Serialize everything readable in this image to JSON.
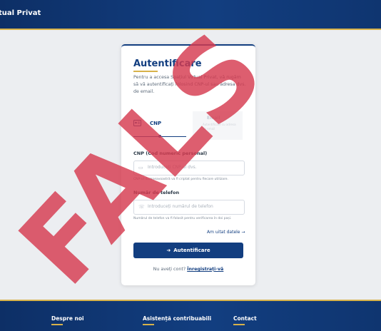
{
  "header": {
    "brand": "tual Privat"
  },
  "card": {
    "title": "Autentificare",
    "description": "Pentru a accesa Spațiul Virtual Privat, vă rugăm să vă autentificați folosind CNP-ul sau adresa dvs. de email.",
    "tabs": [
      {
        "label": "CNP",
        "icon": "id-card-icon",
        "active": true
      },
      {
        "label": "Email",
        "sub": "Autentificare cu adresa de email",
        "icon": "envelope-icon",
        "active": false
      }
    ],
    "cnp_field": {
      "label": "CNP (Cod numeric personal)",
      "placeholder": "Introduceți CNP-ul dvs.",
      "hint": "CNP-ul dumneavoastră va fi criptat pentru fiecare utilizare."
    },
    "phone_field": {
      "label": "Număr de telefon",
      "placeholder": "Introduceți numărul de telefon",
      "hint": "Numărul de telefon va fi folosit pentru verificarea în doi pași."
    },
    "forgot_link": "Am uitat datele →",
    "submit_label": "Autentificare",
    "register_prompt": "Nu aveți cont?",
    "register_link": "Înregistrați-vă"
  },
  "footer": {
    "items": [
      "Despre noi",
      "Asistență contribuabili",
      "Contact"
    ]
  },
  "watermark": {
    "text": "FALS",
    "color": "#d63b4f"
  },
  "colors": {
    "primary": "#123e80",
    "accent": "#d7b24a",
    "background": "#eceef1"
  }
}
